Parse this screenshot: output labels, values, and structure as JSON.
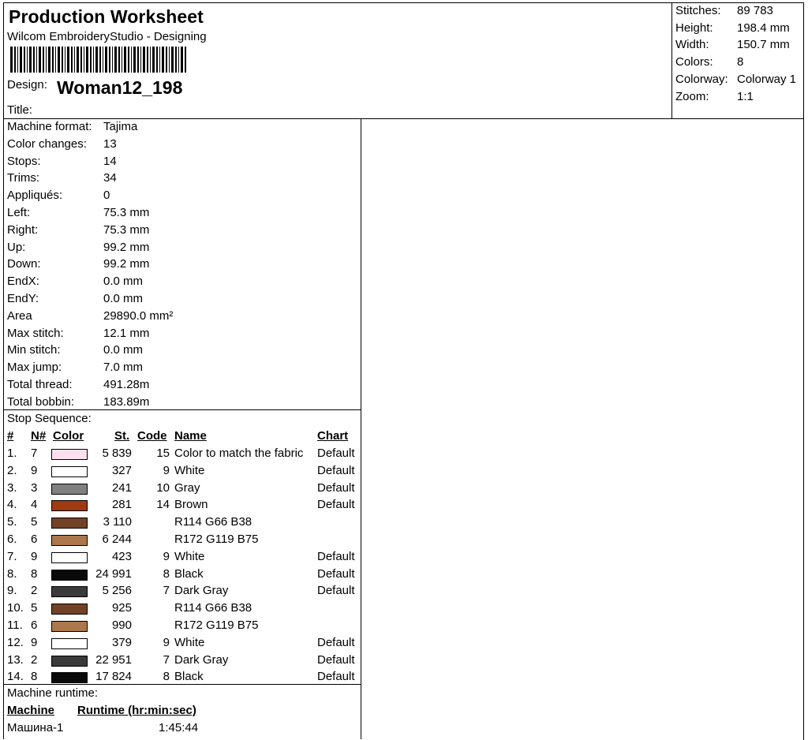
{
  "header": {
    "title": "Production Worksheet",
    "subtitle": "Wilcom EmbroideryStudio - Designing",
    "design_label": "Design:",
    "design_value": "Woman12_198",
    "title_label": "Title:"
  },
  "summary": [
    {
      "label": "Stitches:",
      "value": "89 783"
    },
    {
      "label": "Height:",
      "value": "198.4 mm"
    },
    {
      "label": "Width:",
      "value": "150.7 mm"
    },
    {
      "label": "Colors:",
      "value": "8"
    },
    {
      "label": "Colorway:",
      "value": "Colorway 1"
    },
    {
      "label": "Zoom:",
      "value": "1:1"
    }
  ],
  "details": [
    {
      "label": "Machine format:",
      "value": "Tajima"
    },
    {
      "label": "Color changes:",
      "value": "13"
    },
    {
      "label": "Stops:",
      "value": "14"
    },
    {
      "label": "Trims:",
      "value": "34"
    },
    {
      "label": "Appliqués:",
      "value": "0"
    },
    {
      "label": "Left:",
      "value": "75.3 mm"
    },
    {
      "label": "Right:",
      "value": "75.3 mm"
    },
    {
      "label": "Up:",
      "value": "99.2 mm"
    },
    {
      "label": "Down:",
      "value": "99.2 mm"
    },
    {
      "label": "EndX:",
      "value": "0.0 mm"
    },
    {
      "label": "EndY:",
      "value": "0.0 mm"
    },
    {
      "label": "Area",
      "value": "29890.0 mm²"
    },
    {
      "label": "Max stitch:",
      "value": "12.1 mm"
    },
    {
      "label": "Min stitch:",
      "value": "0.0 mm"
    },
    {
      "label": "Max jump:",
      "value": "7.0 mm"
    },
    {
      "label": "Total thread:",
      "value": "491.28m"
    },
    {
      "label": "Total bobbin:",
      "value": "183.89m"
    }
  ],
  "stop_sequence": {
    "title": "Stop Sequence:",
    "headers": {
      "num": "#",
      "n": "N#",
      "color": "Color",
      "st": "St.",
      "code": "Code",
      "name": "Name",
      "chart": "Chart"
    },
    "rows": [
      {
        "num": "1.",
        "n": "7",
        "color": "#fde0ee",
        "st": "5 839",
        "code": "15",
        "name": "Color to match the fabric",
        "chart": "Default"
      },
      {
        "num": "2.",
        "n": "9",
        "color": "#ffffff",
        "st": "327",
        "code": "9",
        "name": "White",
        "chart": "Default"
      },
      {
        "num": "3.",
        "n": "3",
        "color": "#808080",
        "st": "241",
        "code": "10",
        "name": "Gray",
        "chart": "Default"
      },
      {
        "num": "4.",
        "n": "4",
        "color": "#a03a10",
        "st": "281",
        "code": "14",
        "name": "Brown",
        "chart": "Default"
      },
      {
        "num": "5.",
        "n": "5",
        "color": "#724226",
        "st": "3 110",
        "code": "",
        "name": "R114 G66 B38",
        "chart": ""
      },
      {
        "num": "6.",
        "n": "6",
        "color": "#ac774b",
        "st": "6 244",
        "code": "",
        "name": "R172 G119 B75",
        "chart": ""
      },
      {
        "num": "7.",
        "n": "9",
        "color": "#ffffff",
        "st": "423",
        "code": "9",
        "name": "White",
        "chart": "Default"
      },
      {
        "num": "8.",
        "n": "8",
        "color": "#0a0a0a",
        "st": "24 991",
        "code": "8",
        "name": "Black",
        "chart": "Default"
      },
      {
        "num": "9.",
        "n": "2",
        "color": "#3a3a3a",
        "st": "5 256",
        "code": "7",
        "name": "Dark Gray",
        "chart": "Default"
      },
      {
        "num": "10.",
        "n": "5",
        "color": "#724226",
        "st": "925",
        "code": "",
        "name": "R114 G66 B38",
        "chart": ""
      },
      {
        "num": "11.",
        "n": "6",
        "color": "#ac774b",
        "st": "990",
        "code": "",
        "name": "R172 G119 B75",
        "chart": ""
      },
      {
        "num": "12.",
        "n": "9",
        "color": "#ffffff",
        "st": "379",
        "code": "9",
        "name": "White",
        "chart": "Default"
      },
      {
        "num": "13.",
        "n": "2",
        "color": "#3a3a3a",
        "st": "22 951",
        "code": "7",
        "name": "Dark Gray",
        "chart": "Default"
      },
      {
        "num": "14.",
        "n": "8",
        "color": "#0a0a0a",
        "st": "17 824",
        "code": "8",
        "name": "Black",
        "chart": "Default"
      }
    ]
  },
  "runtime": {
    "label": "Machine runtime:",
    "machine_header": "Machine",
    "runtime_header": "Runtime (hr:min:sec)",
    "machine": "Машина-1",
    "runtime": "1:45:44"
  }
}
